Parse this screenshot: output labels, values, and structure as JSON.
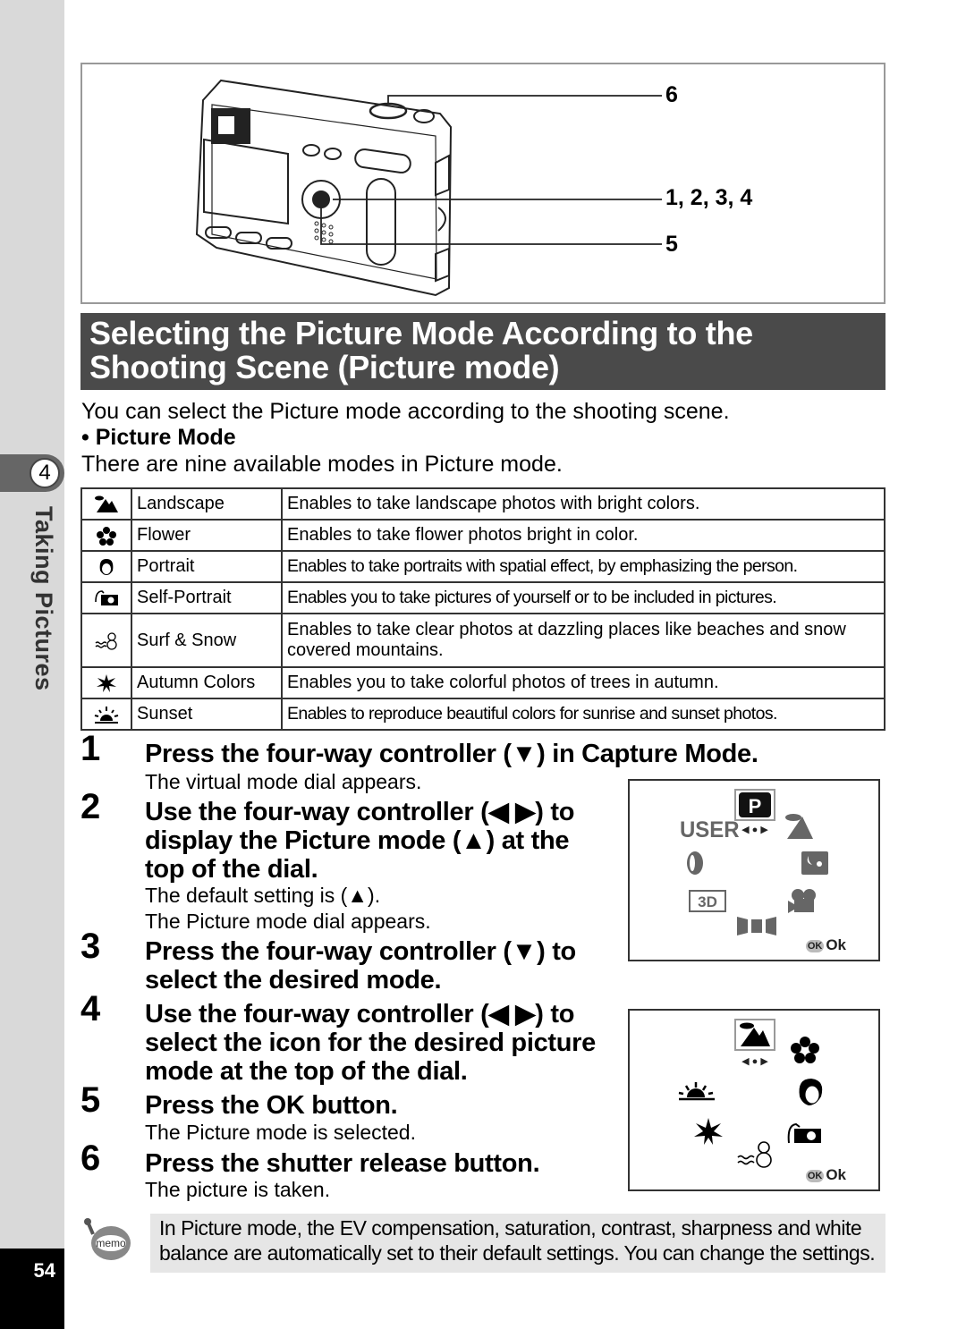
{
  "sidebar": {
    "chapter_number": "4",
    "chapter_title": "Taking Pictures",
    "page_number": "54"
  },
  "figure": {
    "callouts": [
      "6",
      "1, 2, 3, 4",
      "5"
    ],
    "ok_button_label": "OK"
  },
  "section": {
    "heading_line1": "Selecting the Picture Mode According to the",
    "heading_line2": "Shooting Scene (Picture mode)",
    "intro": "You can select the Picture mode according to the shooting scene.",
    "bullet_heading": "• Picture Mode",
    "modes_intro": "There are nine available modes in Picture mode."
  },
  "modes_table": [
    {
      "icon": "landscape-icon",
      "name": "Landscape",
      "description": "Enables to take landscape photos with bright colors."
    },
    {
      "icon": "flower-icon",
      "name": "Flower",
      "description": "Enables to take flower photos bright in color."
    },
    {
      "icon": "portrait-icon",
      "name": "Portrait",
      "description": "Enables to take portraits with spatial effect, by emphasizing the person."
    },
    {
      "icon": "self-portrait-icon",
      "name": "Self-Portrait",
      "description": "Enables you to take pictures of yourself or to be included in pictures."
    },
    {
      "icon": "surf-snow-icon",
      "name": "Surf & Snow",
      "description": "Enables to take clear photos at dazzling places like beaches and snow covered mountains."
    },
    {
      "icon": "autumn-colors-icon",
      "name": "Autumn Colors",
      "description": "Enables you to take colorful photos of trees in autumn."
    },
    {
      "icon": "sunset-icon",
      "name": "Sunset",
      "description": "Enables to reproduce beautiful colors for sunrise and sunset photos."
    }
  ],
  "steps": [
    {
      "number": "1",
      "title": "Press the four-way controller (▼) in Capture Mode.",
      "notes": [
        "The virtual mode dial appears."
      ]
    },
    {
      "number": "2",
      "title_lines": [
        "Use the four-way controller (◀ ▶) to",
        "display the Picture mode (▲) at the",
        "top of the dial."
      ],
      "notes": [
        "The default setting is (▲).",
        "The Picture mode dial appears."
      ]
    },
    {
      "number": "3",
      "title_lines": [
        "Press the four-way controller (▼) to",
        "select the desired mode."
      ],
      "notes": []
    },
    {
      "number": "4",
      "title_lines": [
        "Use the four-way controller (◀ ▶) to",
        "select the icon for the desired picture",
        "mode at the top of the dial."
      ],
      "notes": []
    },
    {
      "number": "5",
      "title": "Press the OK button.",
      "notes": [
        "The Picture mode is selected."
      ]
    },
    {
      "number": "6",
      "title": "Press the shutter release button.",
      "notes": [
        "The picture is taken."
      ]
    }
  ],
  "dial_capture": {
    "selected": "P",
    "labels": [
      "USER",
      "3D"
    ],
    "arrows": "◀ ● ▶",
    "ok_badge": "OK",
    "ok_text": "Ok"
  },
  "dial_picture": {
    "selected": "landscape",
    "arrows": "◀ ● ▶",
    "ok_badge": "OK",
    "ok_text": "Ok"
  },
  "memo": {
    "icon_label": "memo",
    "text_line1": "In Picture mode, the EV compensation, saturation, contrast, sharpness and white",
    "text_line2": "balance are automatically set to their default settings. You can change the settings."
  }
}
